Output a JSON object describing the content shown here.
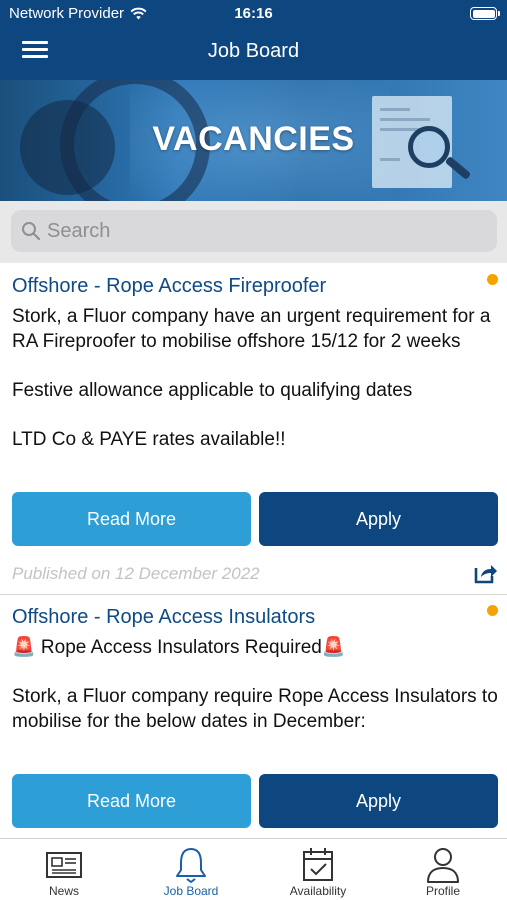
{
  "status_bar": {
    "carrier": "Network Provider",
    "time": "16:16"
  },
  "nav": {
    "title": "Job Board",
    "menu_icon": "hamburger-menu-icon"
  },
  "banner": {
    "title": "VACANCIES"
  },
  "search": {
    "placeholder": "Search",
    "value": ""
  },
  "jobs": [
    {
      "title": "Offshore - Rope Access Fireproofer",
      "description": [
        "Stork, a Fluor company have an urgent requirement for a RA Fireproofer to mobilise offshore 15/12 for 2 weeks",
        "",
        "Festive allowance applicable to qualifying dates",
        "",
        "LTD Co & PAYE rates available!!"
      ],
      "read_more_label": "Read More",
      "apply_label": "Apply",
      "published": "Published on 12 December 2022",
      "status_color": "#f4a300"
    },
    {
      "title": "Offshore - Rope Access Insulators",
      "description": [
        "🚨 Rope Access Insulators Required🚨",
        "",
        "Stork, a Fluor company require Rope Access Insulators to mobilise for the below dates in December:"
      ],
      "read_more_label": "Read More",
      "apply_label": "Apply",
      "status_color": "#f4a300"
    }
  ],
  "tabs": [
    {
      "label": "News",
      "icon": "newspaper-icon",
      "active": false
    },
    {
      "label": "Job Board",
      "icon": "bell-icon",
      "active": true
    },
    {
      "label": "Availability",
      "icon": "calendar-check-icon",
      "active": false
    },
    {
      "label": "Profile",
      "icon": "person-icon",
      "active": false
    }
  ],
  "colors": {
    "brand_navy": "#0e467f",
    "accent_blue": "#2d9ed6",
    "active_tab": "#1a5fa8",
    "status_dot": "#f4a300"
  }
}
